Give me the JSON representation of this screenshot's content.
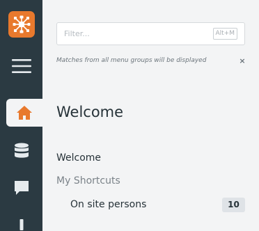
{
  "sidebar": {
    "logo_icon": "org-chart-logo-icon",
    "accent_color": "#e8792d",
    "items": [
      {
        "icon": "hamburger-menu-icon"
      },
      {
        "icon": "home-icon",
        "active": true
      },
      {
        "icon": "database-icon"
      },
      {
        "icon": "chat-icon"
      },
      {
        "icon": "alert-icon"
      }
    ]
  },
  "search": {
    "placeholder": "Filter...",
    "value": "",
    "shortcut": "Alt+M"
  },
  "hint": {
    "text": "Matches from all menu groups will be displayed",
    "close_symbol": "×"
  },
  "main": {
    "title": "Welcome",
    "menu": {
      "welcome_label": "Welcome",
      "shortcuts_label": "My Shortcuts",
      "onsite_label": "On site persons",
      "onsite_count": "10"
    }
  }
}
